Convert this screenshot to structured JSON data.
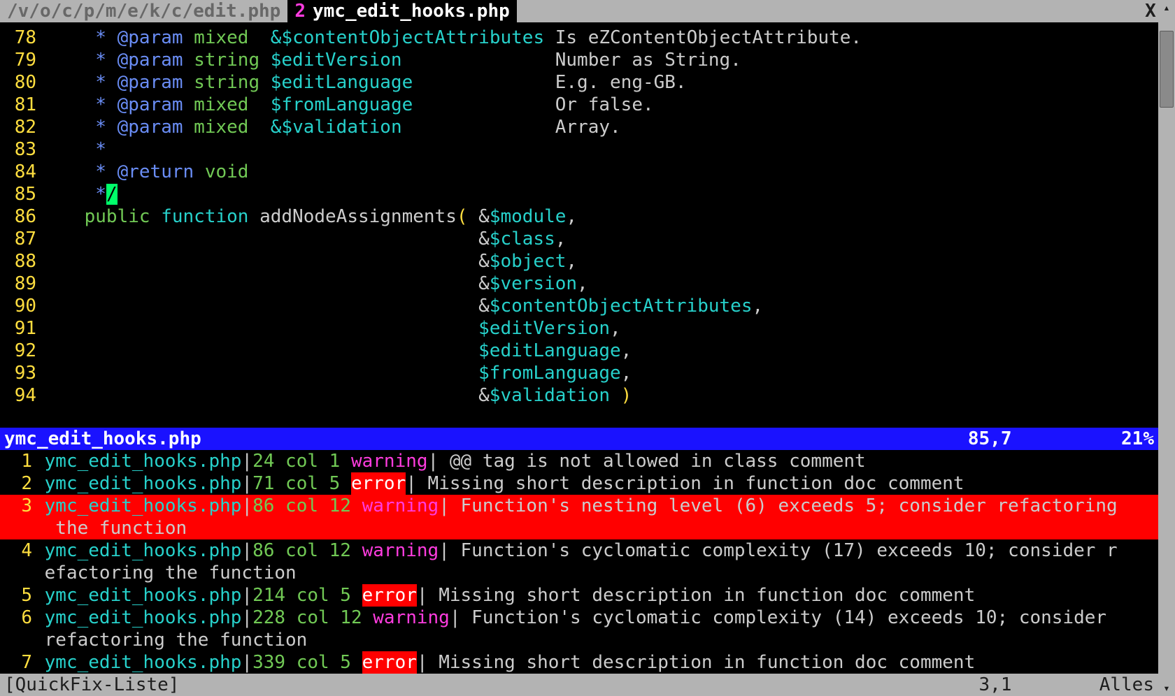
{
  "tabs": {
    "inactive_label": "/v/o/c/p/m/e/k/c/edit.php ",
    "active_num": "2",
    "active_label": "ymc_edit_hooks.php",
    "close_glyph": "X"
  },
  "code": {
    "lines": [
      {
        "n": "78",
        "pre": "     ",
        "star": "*",
        "seg": [
          [
            " ",
            "c"
          ],
          [
            "@param",
            "t"
          ],
          [
            " ",
            "c"
          ],
          [
            "mixed",
            "y"
          ],
          [
            "  ",
            "c"
          ],
          [
            "&$contentObjectAttributes",
            "v"
          ],
          [
            " Is eZContentObjectAttribute.",
            "x"
          ]
        ]
      },
      {
        "n": "79",
        "pre": "     ",
        "star": "*",
        "seg": [
          [
            " ",
            "c"
          ],
          [
            "@param",
            "t"
          ],
          [
            " ",
            "c"
          ],
          [
            "string",
            "y"
          ],
          [
            " ",
            "c"
          ],
          [
            "$editVersion",
            "v"
          ],
          [
            "              Number as String.",
            "x"
          ]
        ]
      },
      {
        "n": "80",
        "pre": "     ",
        "star": "*",
        "seg": [
          [
            " ",
            "c"
          ],
          [
            "@param",
            "t"
          ],
          [
            " ",
            "c"
          ],
          [
            "string",
            "y"
          ],
          [
            " ",
            "c"
          ],
          [
            "$editLanguage",
            "v"
          ],
          [
            "             E.g. eng-GB.",
            "x"
          ]
        ]
      },
      {
        "n": "81",
        "pre": "     ",
        "star": "*",
        "seg": [
          [
            " ",
            "c"
          ],
          [
            "@param",
            "t"
          ],
          [
            " ",
            "c"
          ],
          [
            "mixed",
            "y"
          ],
          [
            "  ",
            "c"
          ],
          [
            "$fromLanguage",
            "v"
          ],
          [
            "             Or false.",
            "x"
          ]
        ]
      },
      {
        "n": "82",
        "pre": "     ",
        "star": "*",
        "seg": [
          [
            " ",
            "c"
          ],
          [
            "@param",
            "t"
          ],
          [
            " ",
            "c"
          ],
          [
            "mixed",
            "y"
          ],
          [
            "  ",
            "c"
          ],
          [
            "&$validation",
            "v"
          ],
          [
            "              Array.",
            "x"
          ]
        ]
      },
      {
        "n": "83",
        "pre": "     ",
        "star": "*",
        "seg": []
      },
      {
        "n": "84",
        "pre": "     ",
        "star": "*",
        "seg": [
          [
            " ",
            "c"
          ],
          [
            "@return",
            "t"
          ],
          [
            " ",
            "c"
          ],
          [
            "void",
            "y"
          ]
        ]
      },
      {
        "n": "85",
        "pre": "     ",
        "star": "*",
        "seg": [
          [
            "/",
            "cursor"
          ]
        ]
      },
      {
        "n": "86",
        "pre": "    ",
        "star": "",
        "seg": [
          [
            "public",
            "kp"
          ],
          [
            " ",
            "p"
          ],
          [
            "function",
            "kf"
          ],
          [
            " ",
            "p"
          ],
          [
            "addNodeAssignments",
            "fn"
          ],
          [
            "( ",
            "pa"
          ],
          [
            "&",
            "amp"
          ],
          [
            "$module",
            "v"
          ],
          [
            ",",
            "p"
          ]
        ]
      },
      {
        "n": "87",
        "pre": "                                        ",
        "star": "",
        "seg": [
          [
            "&",
            "amp"
          ],
          [
            "$class",
            "v"
          ],
          [
            ",",
            "p"
          ]
        ]
      },
      {
        "n": "88",
        "pre": "                                        ",
        "star": "",
        "seg": [
          [
            "&",
            "amp"
          ],
          [
            "$object",
            "v"
          ],
          [
            ",",
            "p"
          ]
        ]
      },
      {
        "n": "89",
        "pre": "                                        ",
        "star": "",
        "seg": [
          [
            "&",
            "amp"
          ],
          [
            "$version",
            "v"
          ],
          [
            ",",
            "p"
          ]
        ]
      },
      {
        "n": "90",
        "pre": "                                        ",
        "star": "",
        "seg": [
          [
            "&",
            "amp"
          ],
          [
            "$contentObjectAttributes",
            "v"
          ],
          [
            ",",
            "p"
          ]
        ]
      },
      {
        "n": "91",
        "pre": "                                        ",
        "star": "",
        "seg": [
          [
            "$editVersion",
            "v"
          ],
          [
            ",",
            "p"
          ]
        ]
      },
      {
        "n": "92",
        "pre": "                                        ",
        "star": "",
        "seg": [
          [
            "$editLanguage",
            "v"
          ],
          [
            ",",
            "p"
          ]
        ]
      },
      {
        "n": "93",
        "pre": "                                        ",
        "star": "",
        "seg": [
          [
            "$fromLanguage",
            "v"
          ],
          [
            ",",
            "p"
          ]
        ]
      },
      {
        "n": "94",
        "pre": "                                        ",
        "star": "",
        "seg": [
          [
            "&",
            "amp"
          ],
          [
            "$validation",
            "v"
          ],
          [
            " ",
            "p"
          ],
          [
            ")",
            "pa"
          ]
        ]
      }
    ]
  },
  "status": {
    "file": "ymc_edit_hooks.php",
    "pos": "85,7",
    "pct": "21%"
  },
  "quickfix": [
    {
      "n": "1",
      "sel": false,
      "file": "ymc_edit_hooks.php",
      "pos": "24 col 1 ",
      "level": "warning",
      "msg": " @@ tag is not allowed in class comment"
    },
    {
      "n": "2",
      "sel": false,
      "file": "ymc_edit_hooks.php",
      "pos": "71 col 5 ",
      "level": "error",
      "msg": " Missing short description in function doc comment"
    },
    {
      "n": "3",
      "sel": true,
      "file": "ymc_edit_hooks.php",
      "pos": "86 col 12 ",
      "level": "warning",
      "msg": " Function's nesting level (6) exceeds 5; consider refactoring",
      "cont": " the function"
    },
    {
      "n": "4",
      "sel": false,
      "file": "ymc_edit_hooks.php",
      "pos": "86 col 12 ",
      "level": "warning",
      "msg": " Function's cyclomatic complexity (17) exceeds 10; consider r",
      "cont": "efactoring the function"
    },
    {
      "n": "5",
      "sel": false,
      "file": "ymc_edit_hooks.php",
      "pos": "214 col 5 ",
      "level": "error",
      "msg": " Missing short description in function doc comment"
    },
    {
      "n": "6",
      "sel": false,
      "file": "ymc_edit_hooks.php",
      "pos": "228 col 12 ",
      "level": "warning",
      "msg": " Function's cyclomatic complexity (14) exceeds 10; consider ",
      "cont": "refactoring the function"
    },
    {
      "n": "7",
      "sel": false,
      "file": "ymc_edit_hooks.php",
      "pos": "339 col 5 ",
      "level": "error",
      "msg": " Missing short description in function doc comment"
    }
  ],
  "cmdline": {
    "left": "[QuickFix-Liste]",
    "pos": "3,1",
    "right": "Alles"
  },
  "scrollbar": {
    "up": "▴",
    "down": "▾"
  }
}
